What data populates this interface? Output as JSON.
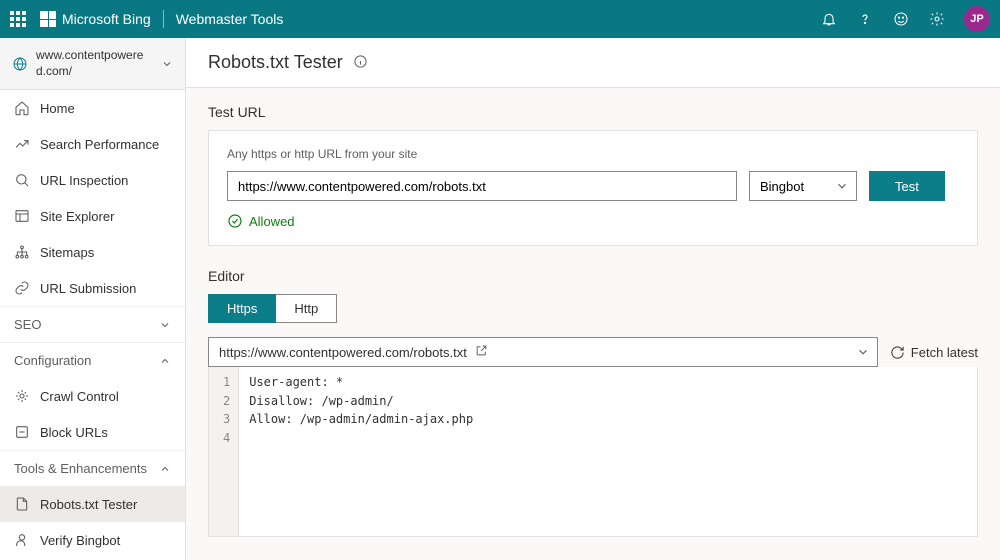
{
  "header": {
    "brand": "Microsoft Bing",
    "tool": "Webmaster Tools",
    "avatar_initials": "JP"
  },
  "sidebar": {
    "site_url": "www.contentpowered.com/",
    "items": [
      {
        "label": "Home"
      },
      {
        "label": "Search Performance"
      },
      {
        "label": "URL Inspection"
      },
      {
        "label": "Site Explorer"
      },
      {
        "label": "Sitemaps"
      },
      {
        "label": "URL Submission"
      }
    ],
    "sections": {
      "seo": "SEO",
      "configuration": "Configuration",
      "tools": "Tools & Enhancements"
    },
    "config_items": [
      {
        "label": "Crawl Control"
      },
      {
        "label": "Block URLs"
      }
    ],
    "tools_items": [
      {
        "label": "Robots.txt Tester"
      },
      {
        "label": "Verify Bingbot"
      }
    ]
  },
  "page": {
    "title": "Robots.txt Tester"
  },
  "test": {
    "section_label": "Test URL",
    "hint": "Any https or http URL from your site",
    "url_value": "https://www.contentpowered.com/robots.txt",
    "bot_selected": "Bingbot",
    "button": "Test",
    "status": "Allowed"
  },
  "editor": {
    "section_label": "Editor",
    "tabs": {
      "https": "Https",
      "http": "Http"
    },
    "path_value": "https://www.contentpowered.com/robots.txt",
    "fetch_label": "Fetch latest",
    "lines": [
      "User-agent: *",
      "Disallow: /wp-admin/",
      "Allow: /wp-admin/admin-ajax.php",
      ""
    ]
  }
}
